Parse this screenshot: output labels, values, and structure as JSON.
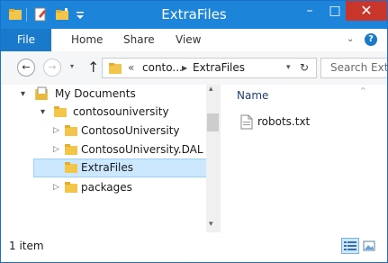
{
  "window": {
    "title": "ExtraFiles",
    "minimize_glyph": "–",
    "maximize_glyph": "□",
    "close_glyph": "✕",
    "accent": "#1c85d9",
    "close_color": "#c7352b"
  },
  "quick_access": {
    "icons": [
      "folder-icon",
      "properties-icon",
      "new-folder-icon",
      "customize-dropdown-icon"
    ]
  },
  "ribbon": {
    "tabs": [
      "File",
      "Home",
      "Share",
      "View"
    ],
    "expand_glyph": "⌄",
    "help_glyph": "?"
  },
  "address": {
    "back_glyph": "←",
    "forward_glyph": "→",
    "recent_glyph": "▾",
    "up_glyph": "↑",
    "overflow": "«",
    "crumbs": [
      "conto...",
      "ExtraFiles"
    ],
    "dropdown_glyph": "▾",
    "refresh_glyph": "↻",
    "search_placeholder": "Search Ext..."
  },
  "nav_tree": {
    "items": [
      {
        "label": "My Documents",
        "expander": "▾",
        "icon": "documents-library-icon",
        "level": 0
      },
      {
        "label": "contosouniversity",
        "expander": "▾",
        "icon": "folder-icon",
        "level": 1
      },
      {
        "label": "ContosoUniversity",
        "expander": "▷",
        "icon": "folder-icon",
        "level": 2
      },
      {
        "label": "ContosoUniversity.DAL",
        "expander": "▷",
        "icon": "folder-icon",
        "level": 2
      },
      {
        "label": "ExtraFiles",
        "expander": "",
        "icon": "folder-icon",
        "level": 2,
        "selected": true
      },
      {
        "label": "packages",
        "expander": "▷",
        "icon": "folder-icon",
        "level": 2
      }
    ],
    "scroll_up_glyph": "▴",
    "scroll_down_glyph": "▾"
  },
  "content": {
    "column_header": "Name",
    "sort_glyph": "^",
    "files": [
      {
        "name": "robots.txt",
        "icon": "text-file-icon"
      }
    ]
  },
  "status": {
    "count_text": "1 item",
    "views": [
      "details-view-icon",
      "large-icons-view-icon"
    ]
  }
}
